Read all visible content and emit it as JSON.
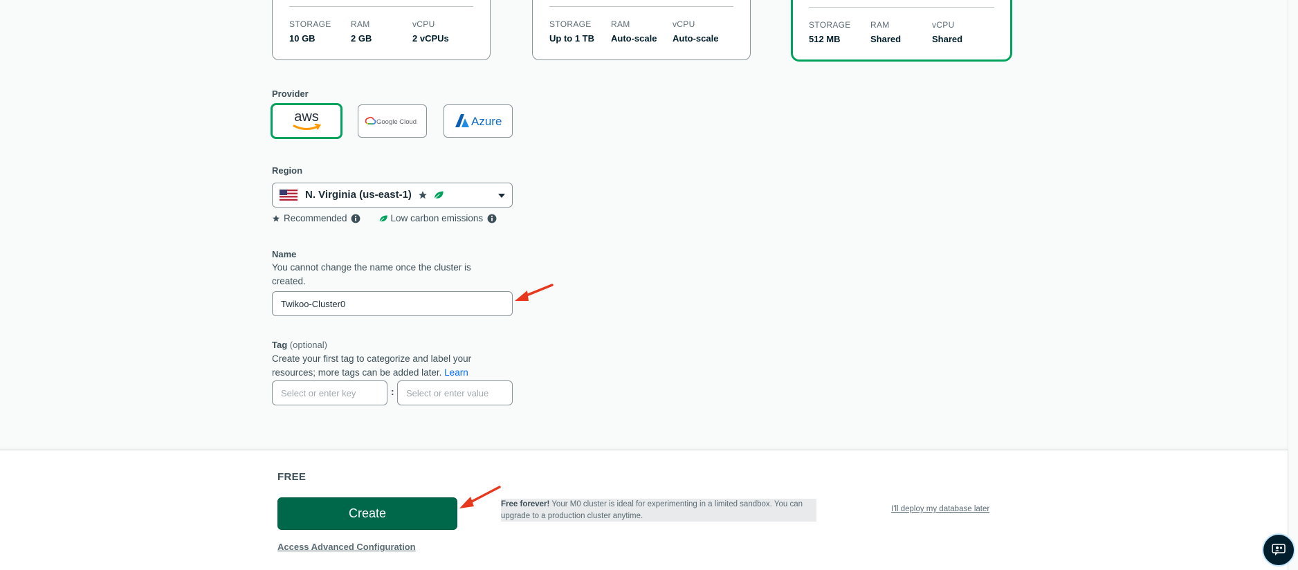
{
  "tiers": [
    {
      "specs": [
        {
          "label": "STORAGE",
          "value": "10 GB"
        },
        {
          "label": "RAM",
          "value": "2 GB"
        },
        {
          "label": "vCPU",
          "value": "2 vCPUs"
        }
      ]
    },
    {
      "specs": [
        {
          "label": "STORAGE",
          "value": "Up to 1 TB"
        },
        {
          "label": "RAM",
          "value": "Auto-scale"
        },
        {
          "label": "vCPU",
          "value": "Auto-scale"
        }
      ]
    },
    {
      "specs": [
        {
          "label": "STORAGE",
          "value": "512 MB"
        },
        {
          "label": "RAM",
          "value": "Shared"
        },
        {
          "label": "vCPU",
          "value": "Shared"
        }
      ]
    }
  ],
  "provider": {
    "label": "Provider",
    "options": [
      {
        "name": "aws",
        "selected": true
      },
      {
        "name": "Google Cloud",
        "selected": false
      },
      {
        "name": "Azure",
        "selected": false
      }
    ]
  },
  "region": {
    "label": "Region",
    "selected": "N. Virginia (us-east-1)",
    "legend_recommended": "Recommended",
    "legend_low_carbon": "Low carbon emissions"
  },
  "name": {
    "label": "Name",
    "help": "You cannot change the name once the cluster is created.",
    "value": "Twikoo-Cluster0"
  },
  "tag": {
    "label": "Tag",
    "optional": "(optional)",
    "help": "Create your first tag to categorize and label your resources; more tags can be added later.",
    "learn_more": "Learn more.",
    "key_placeholder": "Select or enter key",
    "separator": ":",
    "value_placeholder": "Select or enter value"
  },
  "footer": {
    "price": "FREE",
    "create_label": "Create",
    "advanced_link": "Access Advanced Configuration",
    "free_title": "Free forever!",
    "free_text": "Your M0 cluster is ideal for experimenting in a limited sandbox. You can upgrade to a production cluster anytime.",
    "deploy_later": "I'll deploy my database later"
  },
  "colors": {
    "accent": "#00a35c",
    "create_bg": "#00684a",
    "link": "#016bf8",
    "annotation_arrow": "#e8391f"
  }
}
